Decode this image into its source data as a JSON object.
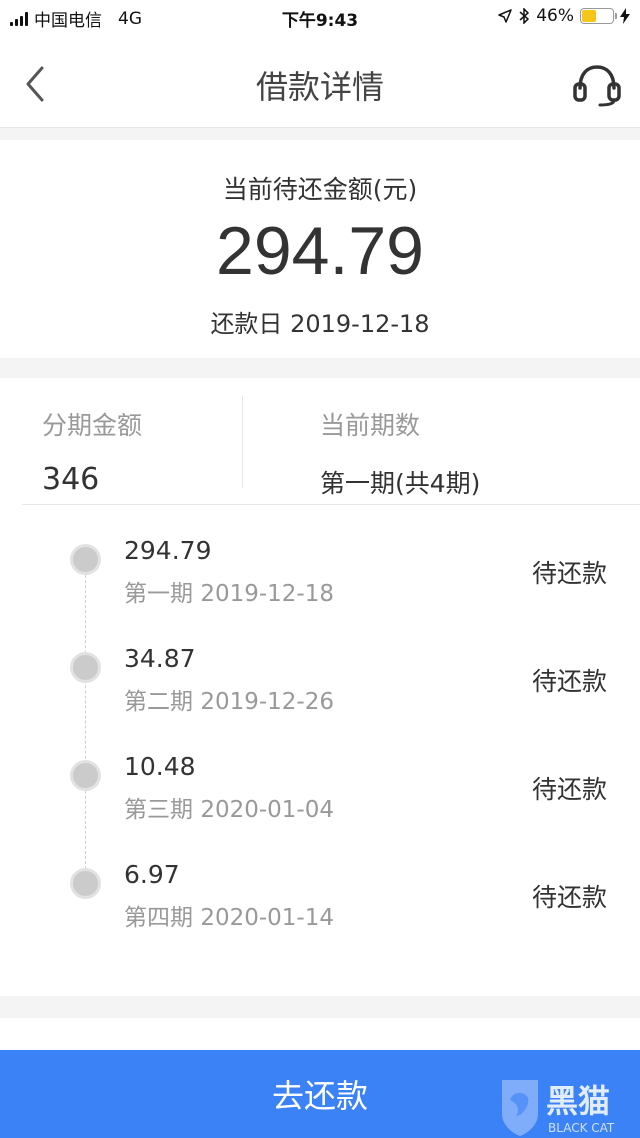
{
  "status_bar": {
    "carrier": "中国电信",
    "network": "4G",
    "time": "下午9:43",
    "battery": "46%",
    "battery_level": 0.46
  },
  "nav": {
    "title": "借款详情",
    "back_icon": "chevron-left-icon",
    "support_icon": "headset-icon"
  },
  "summary": {
    "label": "当前待还金额(元)",
    "amount": "294.79",
    "due_date_label": "还款日",
    "due_date": "2019-12-18"
  },
  "detail": {
    "installment_amount_label": "分期金额",
    "installment_amount": "346",
    "current_period_label": "当前期数",
    "current_period": "第一期(共4期)"
  },
  "plans": [
    {
      "amount": "294.79",
      "period": "第一期",
      "date": "2019-12-18",
      "status": "待还款"
    },
    {
      "amount": "34.87",
      "period": "第二期",
      "date": "2019-12-26",
      "status": "待还款"
    },
    {
      "amount": "10.48",
      "period": "第三期",
      "date": "2020-01-04",
      "status": "待还款"
    },
    {
      "amount": "6.97",
      "period": "第四期",
      "date": "2020-01-14",
      "status": "待还款"
    }
  ],
  "footer": {
    "button_label": "去还款"
  },
  "watermark": {
    "text": "黑猫",
    "sub": "BLACK CAT"
  },
  "colors": {
    "primary": "#3b82f6",
    "battery": "#f5c518"
  }
}
